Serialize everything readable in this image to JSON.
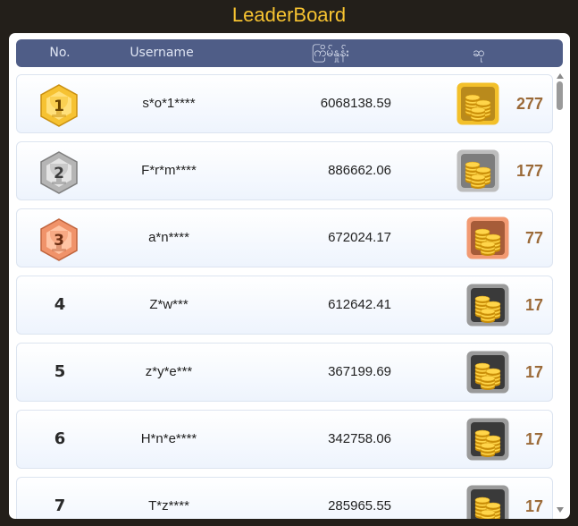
{
  "title": "LeaderBoard",
  "columns": {
    "rank": "No.",
    "username": "Username",
    "score": "ကြိမ်နှုန်း",
    "prize": "ဆု"
  },
  "rows": [
    {
      "rank": "1",
      "username": "s*o*1****",
      "score": "6068138.59",
      "prize": "277",
      "medal": "gold",
      "prize_icon": "coin-stack-gold-frame"
    },
    {
      "rank": "2",
      "username": "F*r*m****",
      "score": "886662.06",
      "prize": "177",
      "medal": "silver",
      "prize_icon": "coin-stack-silver-frame"
    },
    {
      "rank": "3",
      "username": "a*n****",
      "score": "672024.17",
      "prize": "77",
      "medal": "bronze",
      "prize_icon": "coin-stack-bronze-frame"
    },
    {
      "rank": "4",
      "username": "Z*w***",
      "score": "612642.41",
      "prize": "17",
      "medal": "none",
      "prize_icon": "coin-stack-dark-frame"
    },
    {
      "rank": "5",
      "username": "z*y*e***",
      "score": "367199.69",
      "prize": "17",
      "medal": "none",
      "prize_icon": "coin-stack-dark-frame"
    },
    {
      "rank": "6",
      "username": "H*n*e****",
      "score": "342758.06",
      "prize": "17",
      "medal": "none",
      "prize_icon": "coin-stack-dark-frame"
    },
    {
      "rank": "7",
      "username": "T*z****",
      "score": "285965.55",
      "prize": "17",
      "medal": "none",
      "prize_icon": "coin-stack-dark-frame"
    }
  ],
  "colors": {
    "title": "#f7c331",
    "header_bg": "#4f5d87",
    "prize_value": "#9b6a38",
    "gold": "#f5c02c",
    "silver": "#b9b9b9",
    "bronze": "#f0936a"
  }
}
